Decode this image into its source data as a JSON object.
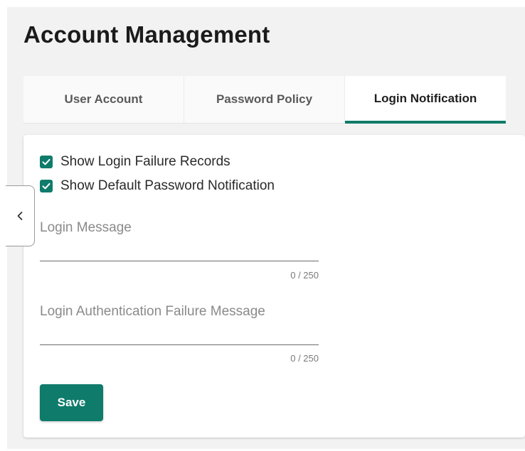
{
  "header": {
    "title": "Account Management"
  },
  "tabs": [
    {
      "label": "User Account",
      "active": false
    },
    {
      "label": "Password Policy",
      "active": false
    },
    {
      "label": "Login Notification",
      "active": true
    }
  ],
  "options": {
    "show_login_failure_records": {
      "label": "Show Login Failure Records",
      "checked": true
    },
    "show_default_password_notification": {
      "label": "Show Default Password Notification",
      "checked": true
    }
  },
  "fields": {
    "login_message": {
      "label": "Login Message",
      "value": "",
      "counter": "0 / 250"
    },
    "login_auth_failure_message": {
      "label": "Login Authentication Failure Message",
      "value": "",
      "counter": "0 / 250"
    }
  },
  "actions": {
    "save_label": "Save"
  },
  "icons": {
    "collapse": "chevron-left-icon",
    "checkbox": "check-icon"
  },
  "colors": {
    "accent": "#0f7b6a",
    "background": "#f2f2f2",
    "card": "#ffffff"
  }
}
